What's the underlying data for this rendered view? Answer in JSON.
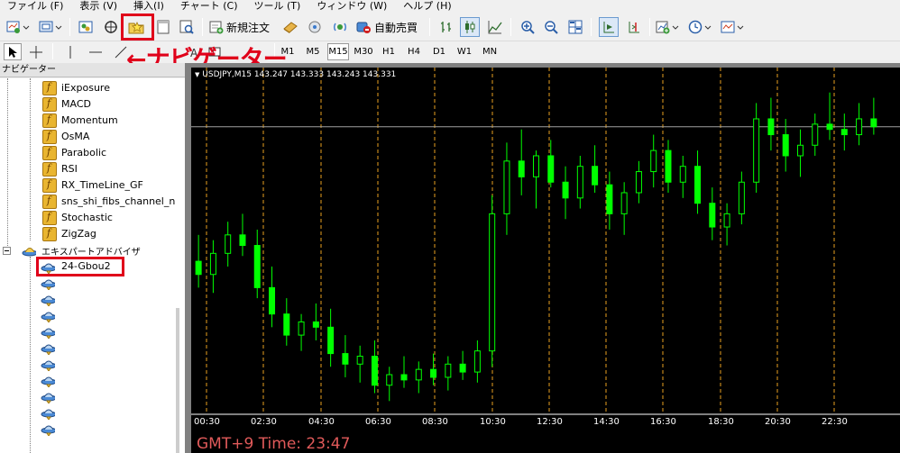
{
  "menu": [
    "ファイル (F)",
    "表示 (V)",
    "挿入(I)",
    "チャート (C)",
    "ツール (T)",
    "ウィンドウ (W)",
    "ヘルプ (H)"
  ],
  "toolbar": {
    "new_order": "新規注文",
    "auto_trading": "自動売買"
  },
  "timeframes": [
    "M1",
    "M5",
    "M15",
    "M30",
    "H1",
    "H4",
    "D1",
    "W1",
    "MN"
  ],
  "active_timeframe": "M15",
  "callout": "←ナビゲーター",
  "navigator": {
    "title": "ナビゲーター",
    "indicators": [
      "iExposure",
      "MACD",
      "Momentum",
      "OsMA",
      "Parabolic",
      "RSI",
      "RX_TimeLine_GF",
      "sns_shi_fibs_channel_n",
      "Stochastic",
      "ZigZag"
    ],
    "expert_advisors_label": "エキスパートアドバイザ",
    "expert_advisors": [
      "24-Gbou2",
      "",
      "",
      "",
      "",
      "",
      "",
      "",
      "",
      "",
      ""
    ]
  },
  "chart": {
    "header": "USDJPY,M15  143.247 143.333 143.243 143.331",
    "footer": "GMT+9 Time: 23:47",
    "time_labels": [
      "00:30",
      "02:30",
      "04:30",
      "06:30",
      "08:30",
      "10:30",
      "12:30",
      "14:30",
      "16:30",
      "18:30",
      "20:30",
      "22:30"
    ],
    "colors": {
      "background": "#000000",
      "candle": "#00ff00",
      "grid_vline": "#e8a020",
      "bid_line": "#a0a0a0",
      "footer_text": "#e05a5a"
    }
  },
  "chart_data": {
    "type": "candlestick",
    "symbol": "USDJPY",
    "timeframe": "M15",
    "x": [
      "00:30",
      "02:30",
      "04:30",
      "06:30",
      "08:30",
      "10:30",
      "12:30",
      "14:30",
      "16:30",
      "18:30",
      "20:30",
      "22:30"
    ],
    "ohlc": [
      [
        142.8,
        142.9,
        142.7,
        142.75
      ],
      [
        142.75,
        142.88,
        142.68,
        142.83
      ],
      [
        142.83,
        142.95,
        142.78,
        142.9
      ],
      [
        142.9,
        142.98,
        142.82,
        142.86
      ],
      [
        142.86,
        142.92,
        142.66,
        142.7
      ],
      [
        142.7,
        142.78,
        142.55,
        142.6
      ],
      [
        142.6,
        142.66,
        142.48,
        142.52
      ],
      [
        142.52,
        142.6,
        142.46,
        142.57
      ],
      [
        142.57,
        142.64,
        142.5,
        142.55
      ],
      [
        142.55,
        142.62,
        142.4,
        142.45
      ],
      [
        142.45,
        142.52,
        142.36,
        142.41
      ],
      [
        142.41,
        142.48,
        142.34,
        142.44
      ],
      [
        142.44,
        142.5,
        142.3,
        142.33
      ],
      [
        142.33,
        142.4,
        142.27,
        142.37
      ],
      [
        142.37,
        142.44,
        142.32,
        142.35
      ],
      [
        142.35,
        142.42,
        142.3,
        142.39
      ],
      [
        142.39,
        142.45,
        142.33,
        142.36
      ],
      [
        142.36,
        142.44,
        142.31,
        142.41
      ],
      [
        142.41,
        142.46,
        142.35,
        142.38
      ],
      [
        142.38,
        142.5,
        142.34,
        142.46
      ],
      [
        142.46,
        143.05,
        142.4,
        142.98
      ],
      [
        142.98,
        143.25,
        142.9,
        143.18
      ],
      [
        143.18,
        143.3,
        143.05,
        143.12
      ],
      [
        143.12,
        143.22,
        143.0,
        143.2
      ],
      [
        143.2,
        143.26,
        143.08,
        143.1
      ],
      [
        143.1,
        143.16,
        142.96,
        143.04
      ],
      [
        143.04,
        143.2,
        143.0,
        143.16
      ],
      [
        143.16,
        143.24,
        143.06,
        143.09
      ],
      [
        143.09,
        143.14,
        142.92,
        142.98
      ],
      [
        142.98,
        143.1,
        142.9,
        143.06
      ],
      [
        143.06,
        143.18,
        143.02,
        143.14
      ],
      [
        143.14,
        143.28,
        143.08,
        143.22
      ],
      [
        143.22,
        143.26,
        143.06,
        143.1
      ],
      [
        143.1,
        143.2,
        143.04,
        143.16
      ],
      [
        143.16,
        143.22,
        142.98,
        143.02
      ],
      [
        143.02,
        143.08,
        142.88,
        142.93
      ],
      [
        142.93,
        143.02,
        142.86,
        142.98
      ],
      [
        142.98,
        143.14,
        142.94,
        143.1
      ],
      [
        143.1,
        143.4,
        143.06,
        143.34
      ],
      [
        143.34,
        143.42,
        143.22,
        143.28
      ],
      [
        143.28,
        143.34,
        143.14,
        143.2
      ],
      [
        143.2,
        143.3,
        143.12,
        143.24
      ],
      [
        143.24,
        143.36,
        143.2,
        143.32
      ],
      [
        143.32,
        143.44,
        143.26,
        143.3
      ],
      [
        143.3,
        143.36,
        143.22,
        143.28
      ],
      [
        143.28,
        143.4,
        143.24,
        143.34
      ],
      [
        143.34,
        143.42,
        143.28,
        143.31
      ]
    ]
  }
}
